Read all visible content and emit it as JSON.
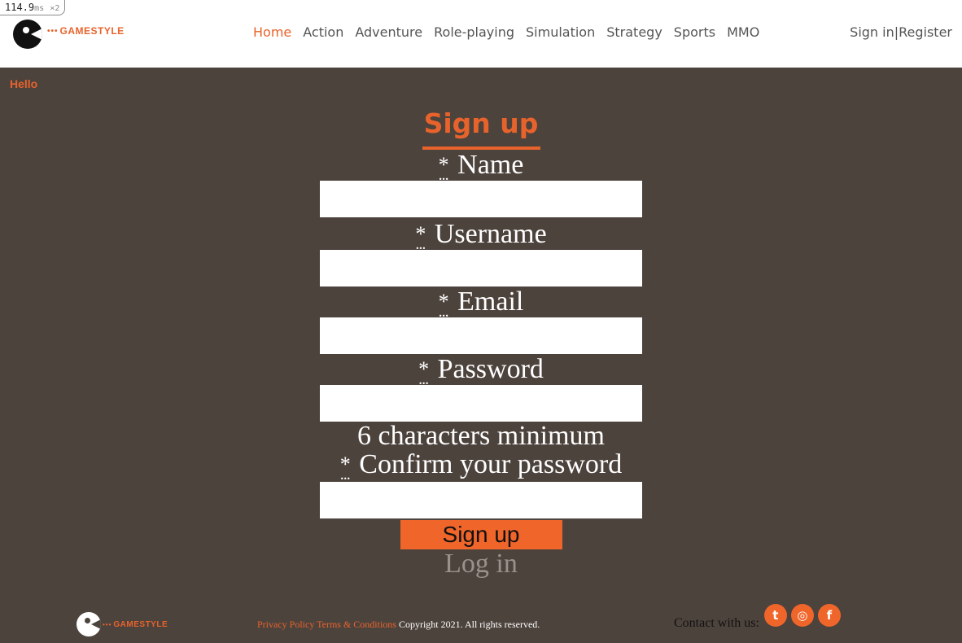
{
  "badge": {
    "value": "114.9",
    "unit": "ms",
    "multiplier": "×2"
  },
  "brand": {
    "name": "GAMESTYLE",
    "accent_color": "#e8632b",
    "background_color": "#4d433d"
  },
  "nav": {
    "items": [
      {
        "label": "Home",
        "active": true
      },
      {
        "label": "Action",
        "active": false
      },
      {
        "label": "Adventure",
        "active": false
      },
      {
        "label": "Role-playing",
        "active": false
      },
      {
        "label": "Simulation",
        "active": false
      },
      {
        "label": "Strategy",
        "active": false
      },
      {
        "label": "Sports",
        "active": false
      },
      {
        "label": "MMO",
        "active": false
      }
    ]
  },
  "auth": {
    "sign_in": "Sign in",
    "separator": "|",
    "register": "Register"
  },
  "greeting": "Hello",
  "form": {
    "title": "Sign up",
    "required_mark": "*",
    "fields": {
      "name": {
        "label": "Name",
        "value": "",
        "placeholder": ""
      },
      "username": {
        "label": "Username",
        "value": "",
        "placeholder": ""
      },
      "email": {
        "label": "Email",
        "value": "",
        "placeholder": ""
      },
      "password": {
        "label": "Password",
        "value": "",
        "placeholder": ""
      },
      "confirm": {
        "label": "Confirm your password",
        "value": "",
        "placeholder": ""
      }
    },
    "password_hint": "6 characters minimum",
    "submit_label": "Sign up",
    "login_label": "Log in"
  },
  "footer": {
    "privacy": "Privacy Policy",
    "terms": "Terms & Conditions",
    "copyright": "Copyright 2021. All rights reserved.",
    "contact_label": "Contact with us:",
    "social": [
      {
        "name": "twitter-icon",
        "glyph": "t"
      },
      {
        "name": "instagram-icon",
        "glyph": "◎"
      },
      {
        "name": "facebook-icon",
        "glyph": "f"
      }
    ]
  }
}
